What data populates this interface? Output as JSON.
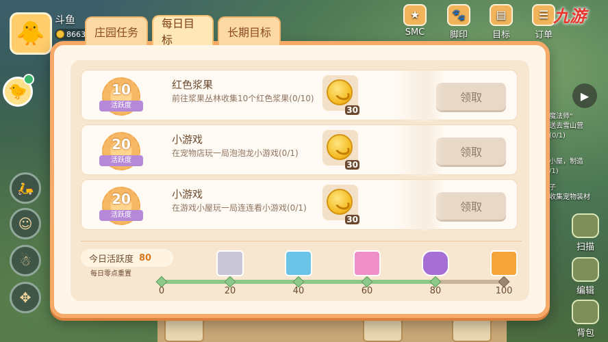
{
  "player": {
    "name": "斗鱼",
    "coins": "8663"
  },
  "top_menu": [
    {
      "label": "SMC",
      "icon": "smc-badge-icon"
    },
    {
      "label": "脚印",
      "icon": "paw-print-icon"
    },
    {
      "label": "目标",
      "icon": "target-book-icon"
    },
    {
      "label": "订单",
      "icon": "order-icon"
    }
  ],
  "logo_text": "九游",
  "tabs": [
    {
      "label": "庄园任务",
      "active": false
    },
    {
      "label": "每日目标",
      "active": true
    },
    {
      "label": "长期目标",
      "active": false
    }
  ],
  "tasks": [
    {
      "badge_value": "10",
      "badge_label": "活跃度",
      "title": "红色浆果",
      "desc": "前往浆果丛林收集10个红色浆果(0/10)",
      "reward_qty": "30",
      "claim_label": "领取"
    },
    {
      "badge_value": "20",
      "badge_label": "活跃度",
      "title": "小游戏",
      "desc": "在宠物店玩一局泡泡龙小游戏(0/1)",
      "reward_qty": "30",
      "claim_label": "领取"
    },
    {
      "badge_value": "20",
      "badge_label": "活跃度",
      "title": "小游戏",
      "desc": "在游戏小屋玩一局连连看小游戏(0/1)",
      "reward_qty": "30",
      "claim_label": "领取"
    }
  ],
  "activity": {
    "label": "今日活跃度",
    "value": "80",
    "reset_note": "每日零点重置",
    "progress_percent": 80,
    "milestones": [
      "0",
      "20",
      "40",
      "60",
      "80",
      "100"
    ]
  },
  "side_panel": {
    "text_lines": [
      "魔法师\"",
      "送去雪山营",
      "(0/1)",
      "小屋，制造",
      "/1)",
      "子",
      "收集宠物装材"
    ],
    "buttons": [
      {
        "label": "扫描",
        "icon": "satellite-dish-icon"
      },
      {
        "label": "编辑",
        "icon": "edit-icon"
      },
      {
        "label": "背包",
        "icon": "backpack-icon"
      }
    ]
  }
}
